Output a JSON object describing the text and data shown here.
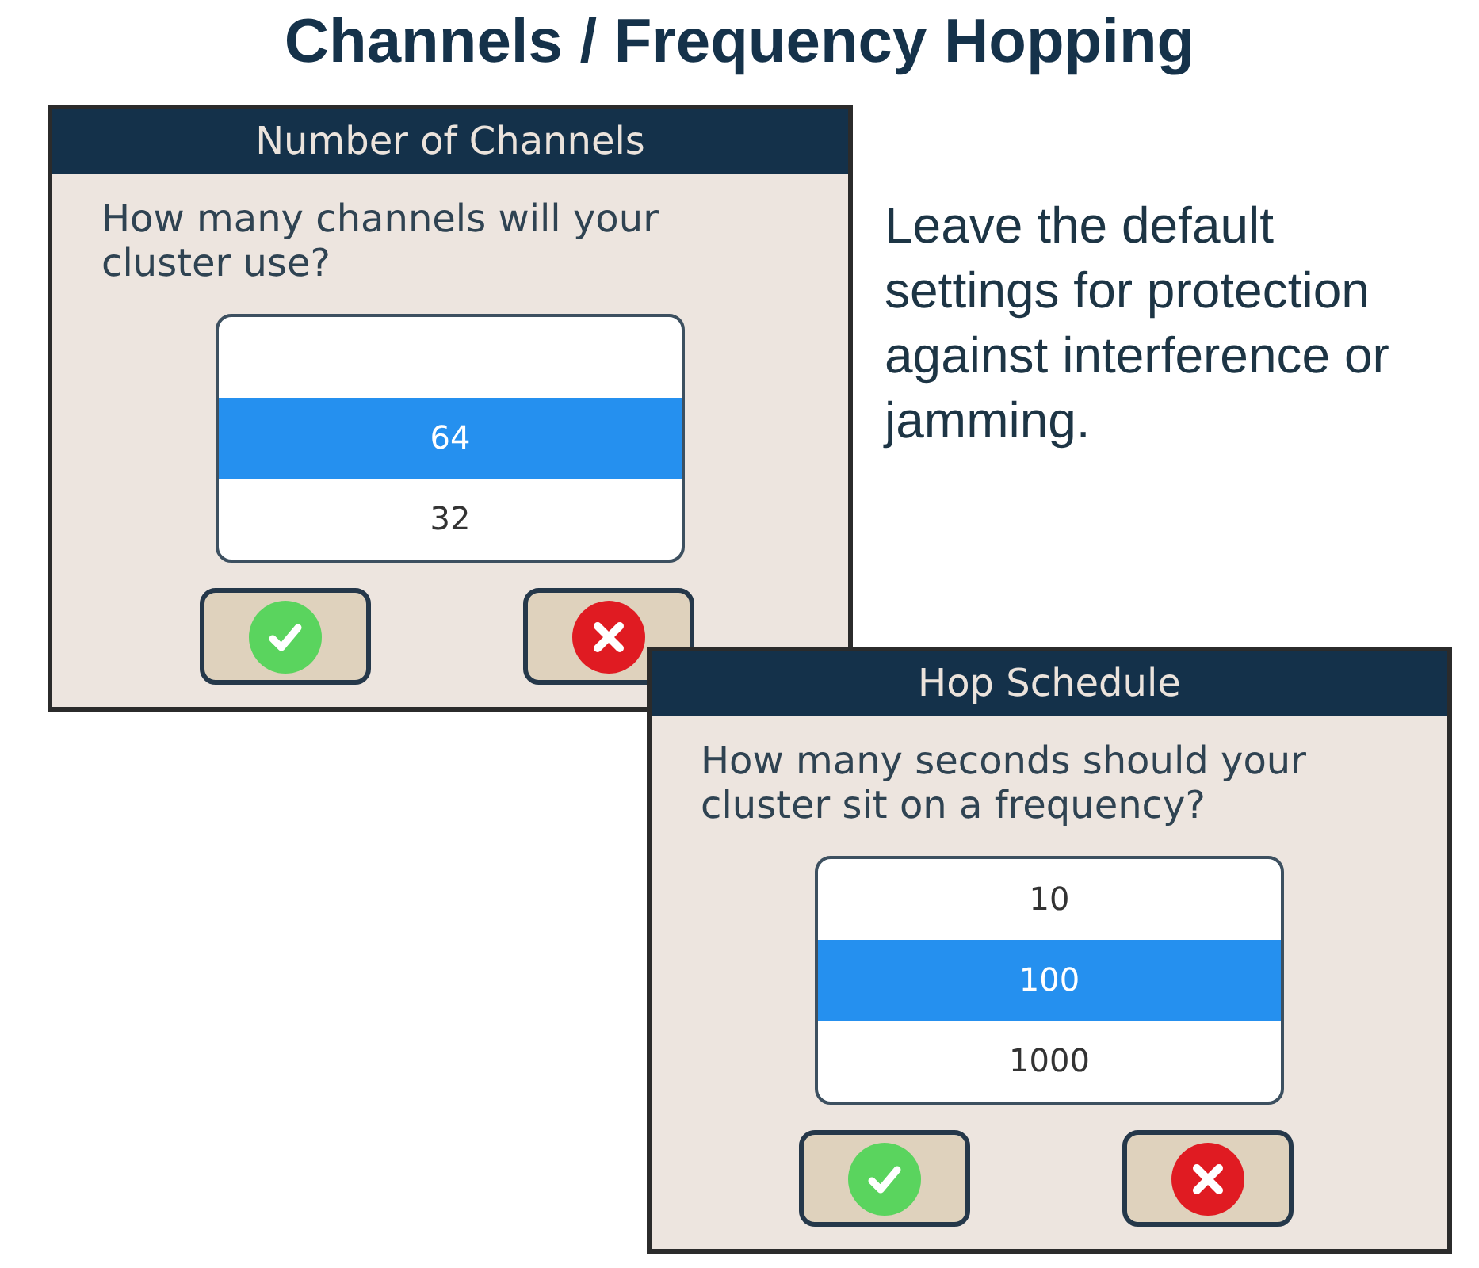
{
  "title": "Channels / Frequency Hopping",
  "dialogs": [
    {
      "title": "Number of Channels",
      "question": "How many channels will your cluster use?",
      "options": [
        {
          "label": "64",
          "selected": true
        },
        {
          "label": "32",
          "selected": false
        }
      ],
      "buttons": [
        {
          "kind": "confirm"
        },
        {
          "kind": "cancel"
        }
      ]
    },
    {
      "title": "Hop Schedule",
      "question": "How many seconds should your cluster sit on a frequency?",
      "options": [
        {
          "label": "10",
          "selected": false
        },
        {
          "label": "100",
          "selected": true
        },
        {
          "label": "1000",
          "selected": false
        }
      ],
      "buttons": [
        {
          "kind": "confirm"
        },
        {
          "kind": "cancel"
        }
      ]
    }
  ],
  "note": "Leave the default settings for protection against interference or jamming."
}
